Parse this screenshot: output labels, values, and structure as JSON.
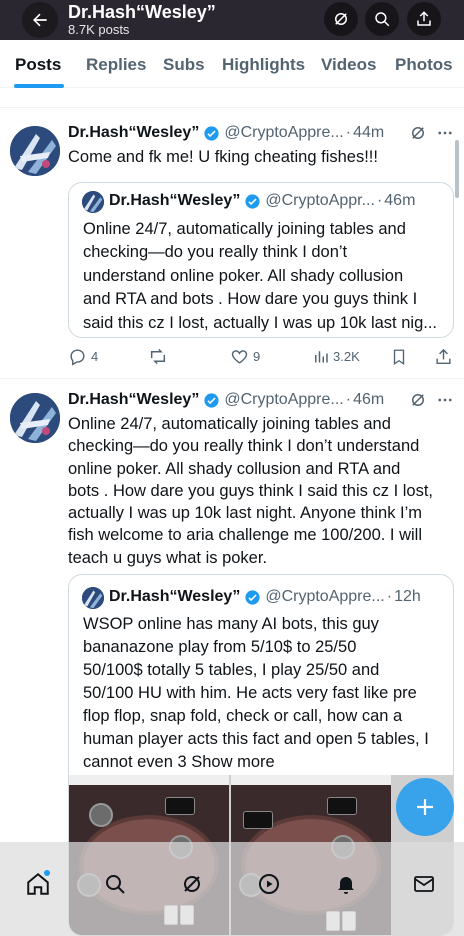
{
  "header": {
    "title": "Dr.Hash“Wesley”",
    "subtitle": "8.7K posts"
  },
  "tabs": [
    {
      "label": "Posts",
      "active": true
    },
    {
      "label": "Replies",
      "active": false
    },
    {
      "label": "Subs",
      "active": false
    },
    {
      "label": "Highlights",
      "active": false
    },
    {
      "label": "Videos",
      "active": false
    },
    {
      "label": "Photos",
      "active": false
    }
  ],
  "post1": {
    "name": "Dr.Hash“Wesley”",
    "handle": "@CryptoAppre...",
    "time": "44m",
    "text": "Come and fk me! U fking cheating fishes!!!",
    "quote": {
      "name": "Dr.Hash“Wesley”",
      "handle": "@CryptoAppr...",
      "time": "46m",
      "lines": [
        "Online 24/7, automatically joining tables and",
        "checking—do you really think I don’t",
        "understand online poker. All shady collusion",
        "and RTA and bots . How dare you guys think I",
        "said this cz I lost, actually I was up 10k last nig..."
      ]
    },
    "actions": {
      "replies": "4",
      "reposts": "",
      "likes": "9",
      "views": "3.2K"
    }
  },
  "post2": {
    "name": "Dr.Hash“Wesley”",
    "handle": "@CryptoAppre...",
    "time": "46m",
    "lines": [
      "Online 24/7, automatically joining tables and",
      "checking—do you really think I don’t understand",
      "online poker. All shady collusion and RTA and",
      "bots . How dare you guys think I said this cz I lost,",
      "actually I was up 10k last night. Anyone think I’m",
      "fish welcome to aria challenge me 100/200. I will",
      "teach u guys what is poker."
    ],
    "quote": {
      "name": "Dr.Hash“Wesley”",
      "handle": "@CryptoAppre...",
      "time": "12h",
      "lines": [
        "WSOP online has many AI bots, this guy",
        "bananazone play from 5/10$ to 25/50",
        "50/100$ totally 5 tables, I play 25/50 and",
        "50/100 HU with him. He acts very fast like pre",
        "flop flop, snap fold, check or call, how can a",
        "human player acts this fact and open 5 tables, I",
        "cannot even 3 Show more"
      ]
    }
  },
  "nav": [
    "home-icon",
    "search-icon",
    "grok-icon",
    "play-icon",
    "bell-icon",
    "mail-icon"
  ],
  "colors": {
    "accent": "#1d9bf0",
    "header_bg": "#2b2730",
    "text_secondary": "#536471",
    "border": "#cfd9de"
  }
}
